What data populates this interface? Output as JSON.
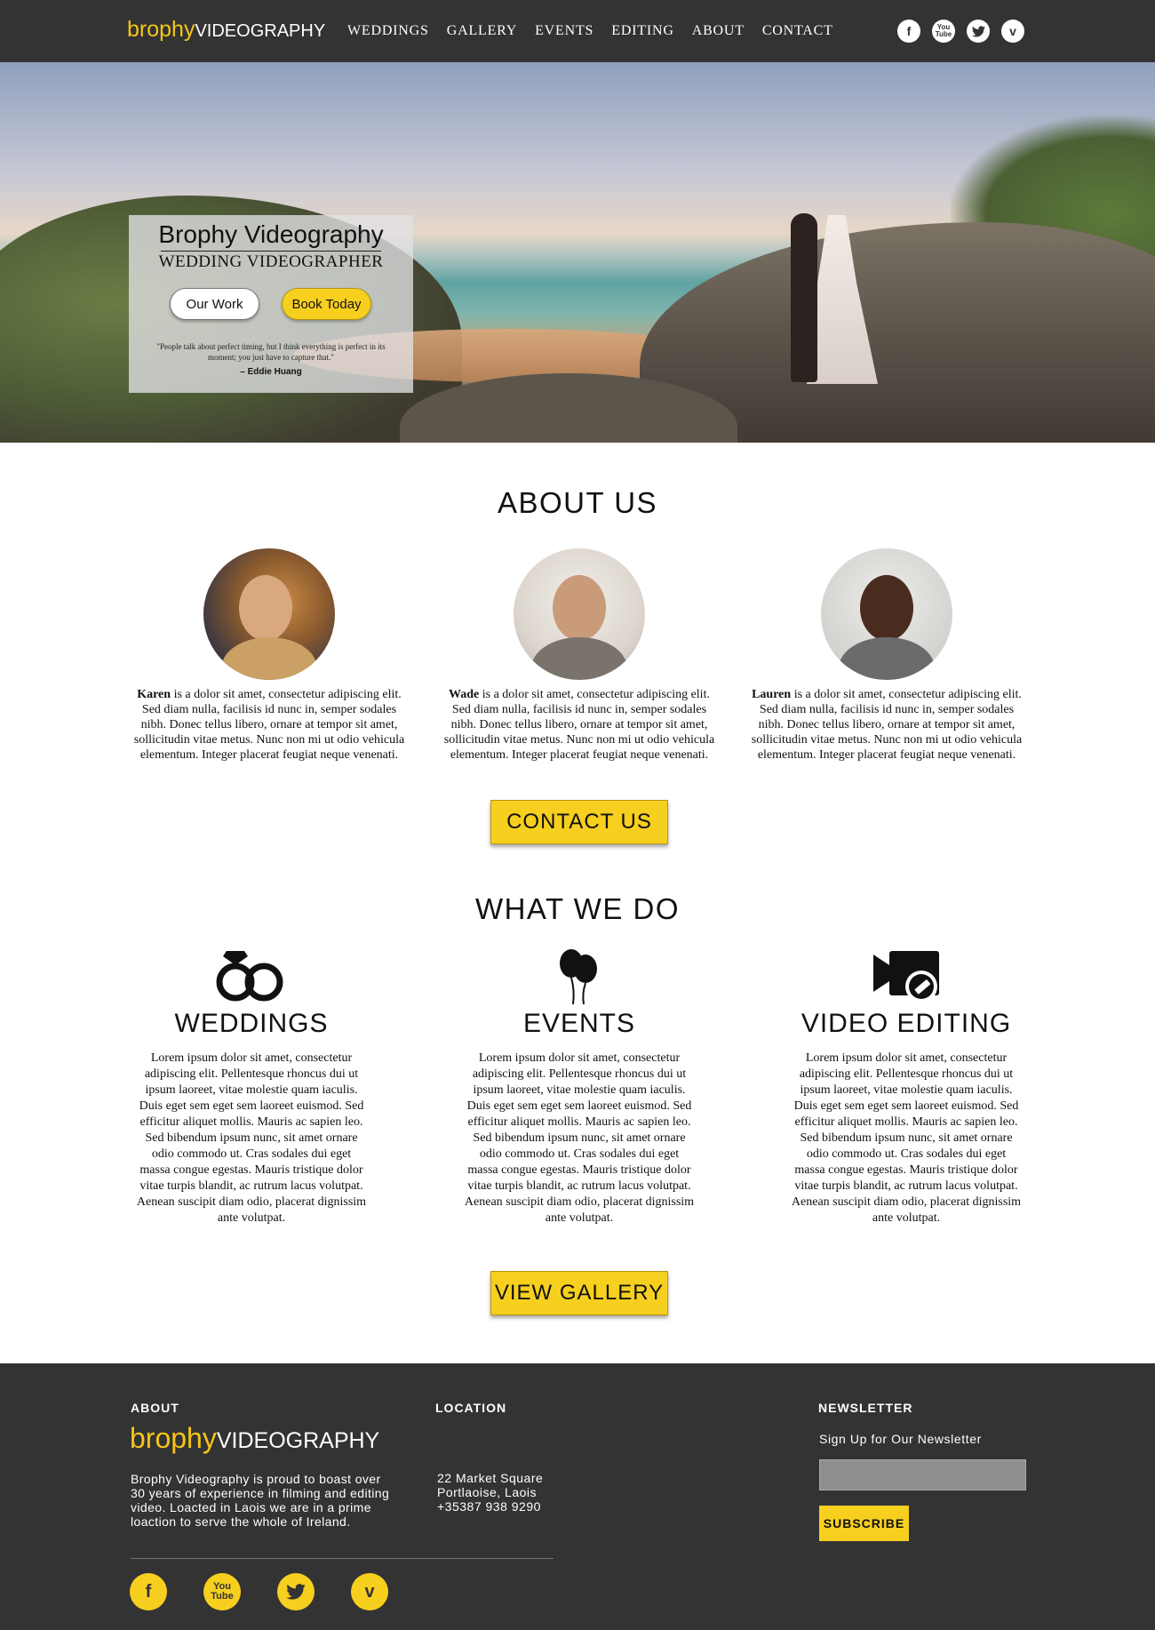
{
  "nav": {
    "logo_brand": "brophy",
    "logo_word": "VIDEOGRAPHY",
    "menu": [
      "WEDDINGS",
      "GALLERY",
      "EVENTS",
      "EDITING",
      "ABOUT",
      "CONTACT"
    ],
    "social": [
      "facebook-icon",
      "youtube-icon",
      "twitter-icon",
      "vimeo-icon"
    ]
  },
  "hero": {
    "title": "Brophy Videography",
    "subtitle": "WEDDING VIDEOGRAPHER",
    "btn_work": "Our Work",
    "btn_book": "Book Today",
    "quote": "\"People talk about perfect timing, but I think everything is perfect in its moment; you just have to capture that.\"",
    "author": "– Eddie Huang"
  },
  "about": {
    "heading": "ABOUT US",
    "members": [
      {
        "name": "Karen",
        "bio": " is a dolor sit amet, consectetur adipiscing elit. Sed diam nulla, facilisis id nunc in, semper sodales nibh. Donec tellus libero, ornare at tempor sit amet, sollicitudin vitae metus. Nunc non mi ut odio vehicula elementum. Integer placerat feugiat neque venenati."
      },
      {
        "name": "Wade",
        "bio": " is a dolor sit amet, consectetur adipiscing elit. Sed diam nulla, facilisis id nunc in, semper sodales nibh. Donec tellus libero, ornare at tempor sit amet, sollicitudin vitae metus. Nunc non mi ut odio vehicula elementum. Integer placerat feugiat neque venenati."
      },
      {
        "name": "Lauren",
        "bio": " is a dolor sit amet, consectetur adipiscing elit. Sed diam nulla, facilisis id nunc in, semper sodales nibh. Donec tellus libero, ornare at tempor sit amet, sollicitudin vitae metus. Nunc non mi ut odio vehicula elementum. Integer placerat feugiat neque venenati."
      }
    ],
    "cta": "CONTACT US"
  },
  "services": {
    "heading": "WHAT WE DO",
    "items": [
      {
        "title": "WEDDINGS",
        "icon": "rings-icon",
        "text": "Lorem ipsum dolor sit amet, consectetur adipiscing elit. Pellentesque rhoncus dui ut ipsum laoreet, vitae molestie quam iaculis. Duis eget sem eget sem laoreet euismod. Sed efficitur aliquet mollis. Mauris ac sapien leo. Sed bibendum ipsum nunc, sit amet ornare odio commodo ut. Cras sodales dui eget massa congue egestas. Mauris tristique dolor vitae turpis blandit, ac rutrum lacus volutpat. Aenean suscipit diam odio, placerat dignissim ante volutpat."
      },
      {
        "title": "EVENTS",
        "icon": "balloons-icon",
        "text": "Lorem ipsum dolor sit amet, consectetur adipiscing elit. Pellentesque rhoncus dui ut ipsum laoreet, vitae molestie quam iaculis. Duis eget sem eget sem laoreet euismod. Sed efficitur aliquet mollis. Mauris ac sapien leo. Sed bibendum ipsum nunc, sit amet ornare odio commodo ut. Cras sodales dui eget massa congue egestas. Mauris tristique dolor vitae turpis blandit, ac rutrum lacus volutpat. Aenean suscipit diam odio, placerat dignissim ante volutpat."
      },
      {
        "title": "VIDEO EDITING",
        "icon": "video-edit-icon",
        "text": "Lorem ipsum dolor sit amet, consectetur adipiscing elit. Pellentesque rhoncus dui ut ipsum laoreet, vitae molestie quam iaculis. Duis eget sem eget sem laoreet euismod. Sed efficitur aliquet mollis. Mauris ac sapien leo. Sed bibendum ipsum nunc, sit amet ornare odio commodo ut. Cras sodales dui eget massa congue egestas. Mauris tristique dolor vitae turpis blandit, ac rutrum lacus volutpat. Aenean suscipit diam odio, placerat dignissim ante volutpat."
      }
    ],
    "cta": "VIEW GALLERY"
  },
  "footer": {
    "about_heading": "ABOUT",
    "logo_brand": "brophy",
    "logo_word": "VIDEOGRAPHY",
    "about_text": "Brophy Videography is proud to boast over 30 years of experience in filming and editing video. Loacted in Laois we are in a prime loaction to serve the whole of Ireland.",
    "location_heading": "LOCATION",
    "address_line1": "22 Market Square",
    "address_line2": "Portlaoise, Laois",
    "phone": "+35387 938 9290",
    "newsletter_heading": "NEWSLETTER",
    "newsletter_label": "Sign Up for Our Newsletter",
    "newsletter_value": "",
    "subscribe": "SUBSCRIBE",
    "social": [
      "facebook-icon",
      "youtube-icon",
      "twitter-icon",
      "vimeo-icon"
    ]
  },
  "colors": {
    "accent": "#f6cf1f",
    "dark": "#333333"
  }
}
